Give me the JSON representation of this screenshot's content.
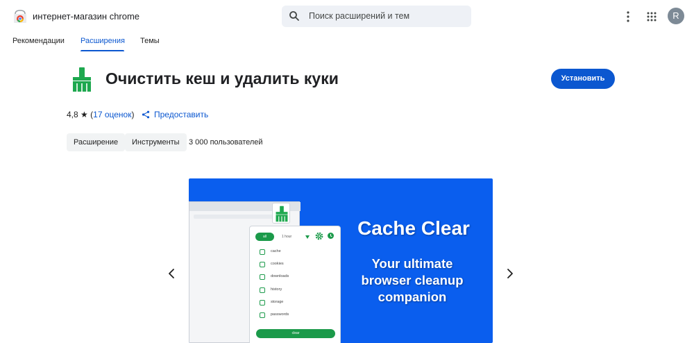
{
  "header": {
    "store_title": "интернет-магазин chrome",
    "search_placeholder": "Поиск расширений и тем",
    "avatar_letter": "R"
  },
  "nav": {
    "tabs": [
      {
        "label": "Рекомендации",
        "active": false
      },
      {
        "label": "Расширения",
        "active": true
      },
      {
        "label": "Темы",
        "active": false
      }
    ]
  },
  "extension": {
    "title": "Очистить кеш и удалить куки",
    "install_label": "Установить",
    "rating": "4,8",
    "rating_star": "★",
    "ratings_count": "17 оценок",
    "share_label": "Предоставить",
    "chips": [
      "Расширение",
      "Инструменты"
    ],
    "users": "3 000 пользователей"
  },
  "screenshot": {
    "title": "Cache Clear",
    "subtitle": "Your ultimate browser cleanup companion",
    "popup": {
      "all_label": "all",
      "time_label": "1 hour",
      "options": [
        "cache",
        "cookies",
        "downloads",
        "history",
        "storage",
        "passwords"
      ],
      "clear_label": "clear"
    }
  },
  "colors": {
    "accent": "#0b57d0",
    "slide_bg": "#0a5eee",
    "popup_green": "#1b9a4a",
    "icon_green": "#1ea84f"
  },
  "icons": {
    "logo": "chrome-web-store-logo",
    "search": "search-icon",
    "menu": "more-vert-icon",
    "apps": "apps-grid-icon",
    "share": "share-icon",
    "prev": "chevron-left-icon",
    "next": "chevron-right-icon",
    "extension": "broom-icon"
  }
}
